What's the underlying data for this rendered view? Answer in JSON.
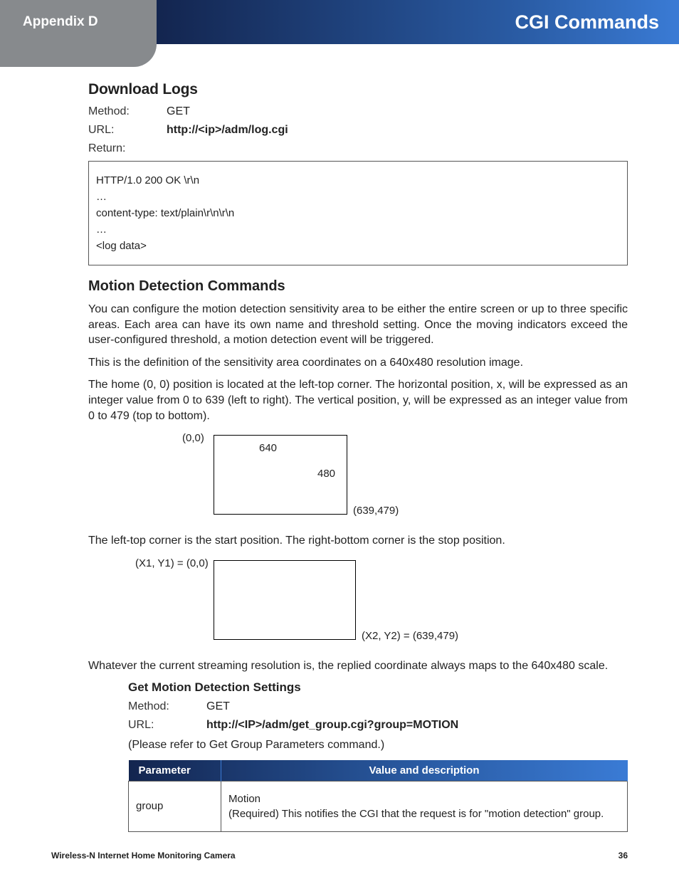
{
  "header": {
    "appendix": "Appendix D",
    "title": "CGI Commands"
  },
  "download_logs": {
    "heading": "Download Logs",
    "method_label": "Method:",
    "method_value": "GET",
    "url_label": "URL:",
    "url_value": "http://<ip>/adm/log.cgi",
    "return_label": "Return:",
    "code": [
      "HTTP/1.0 200 OK \\r\\n",
      "…",
      "content-type: text/plain\\r\\n\\r\\n",
      "…",
      "<log data>"
    ]
  },
  "motion": {
    "heading": "Motion Detection Commands",
    "p1": "You can configure the motion detection sensitivity area to be either the entire screen or up to three specific areas. Each area can have its own name and threshold setting. Once the moving indicators exceed the user-configured threshold, a motion detection event will be triggered.",
    "p2": "This is the definition of the sensitivity area coordinates on a 640x480 resolution image.",
    "p3": "The home (0, 0) position is located at the left-top corner. The horizontal position, x, will be expressed as an integer value from 0 to 639 (left to right). The vertical position, y, will be expressed as an integer value from 0 to 479 (top to bottom).",
    "diagram1": {
      "tl": "(0,0)",
      "w": "640",
      "h": "480",
      "br": "(639,479)"
    },
    "p4": "The left-top corner is the start position. The right-bottom corner is the stop position.",
    "diagram2": {
      "tl": "(X1, Y1) = (0,0)",
      "br": "(X2, Y2) = (639,479)"
    },
    "p5": "Whatever the current streaming resolution is, the replied coordinate always maps to the 640x480 scale."
  },
  "get_motion": {
    "heading": "Get Motion Detection Settings",
    "method_label": "Method:",
    "method_value": "GET",
    "url_label": "URL:",
    "url_value": "http://<IP>/adm/get_group.cgi?group=MOTION",
    "note": "(Please refer to Get Group Parameters command.)",
    "table": {
      "h1": "Parameter",
      "h2": "Value and description",
      "row1_param": "group",
      "row1_v1": "Motion",
      "row1_v2": "(Required) This notifies the CGI that the request is for \"motion detection\" group."
    }
  },
  "footer": {
    "left": "Wireless-N Internet Home Monitoring Camera",
    "right": "36"
  }
}
